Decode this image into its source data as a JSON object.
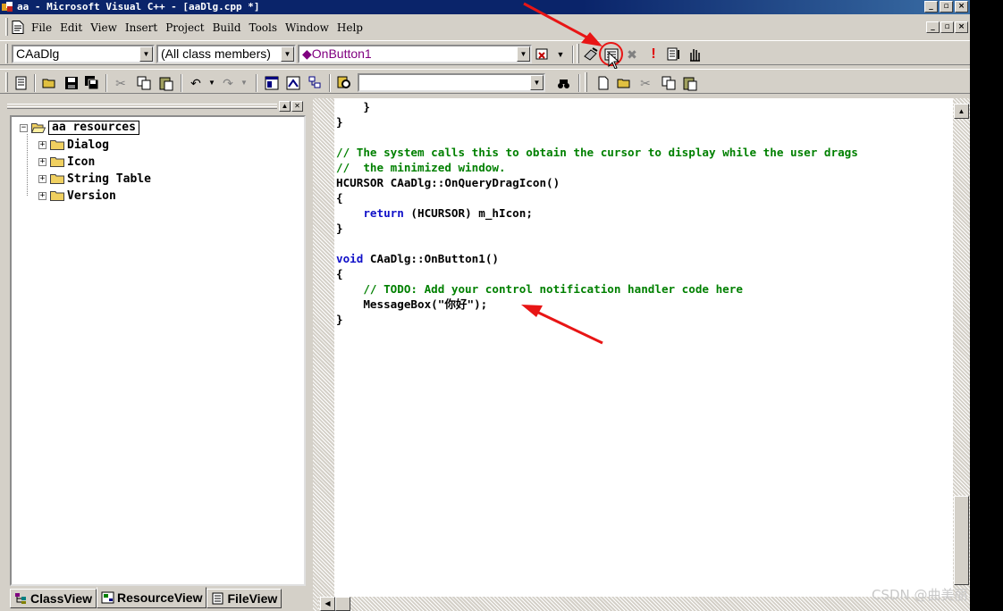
{
  "window": {
    "title": "aa - Microsoft Visual C++ - [aaDlg.cpp *]",
    "controls": [
      "_",
      "▫",
      "×"
    ]
  },
  "menu": {
    "items": [
      "File",
      "Edit",
      "View",
      "Insert",
      "Project",
      "Build",
      "Tools",
      "Window",
      "Help"
    ]
  },
  "toolbar1": {
    "class_combo": "CAaDlg",
    "filter_combo": "(All class members)",
    "member_combo": "◆OnButton1"
  },
  "toolbar2": {
    "find_combo": ""
  },
  "workspace": {
    "root": "aa resources",
    "items": [
      "Dialog",
      "Icon",
      "String Table",
      "Version"
    ],
    "tabs": [
      "ClassView",
      "ResourceView",
      "FileView"
    ]
  },
  "editor": {
    "lines": [
      [
        {
          "t": "    }",
          "c": "pl"
        }
      ],
      [
        {
          "t": "}",
          "c": "pl"
        }
      ],
      [],
      [
        {
          "t": "// The system calls this to obtain the cursor to display while the user drags",
          "c": "cm"
        }
      ],
      [
        {
          "t": "//  the minimized window.",
          "c": "cm"
        }
      ],
      [
        {
          "t": "HCURSOR CAaDlg::OnQueryDragIcon()",
          "c": "pl"
        }
      ],
      [
        {
          "t": "{",
          "c": "pl"
        }
      ],
      [
        {
          "t": "    ",
          "c": "pl"
        },
        {
          "t": "return",
          "c": "kw"
        },
        {
          "t": " (HCURSOR) m_hIcon;",
          "c": "pl"
        }
      ],
      [
        {
          "t": "}",
          "c": "pl"
        }
      ],
      [],
      [
        {
          "t": "void",
          "c": "kw"
        },
        {
          "t": " CAaDlg::OnButton1()",
          "c": "pl"
        }
      ],
      [
        {
          "t": "{",
          "c": "pl"
        }
      ],
      [
        {
          "t": "    // TODO: Add your control notification handler code here",
          "c": "cm"
        }
      ],
      [
        {
          "t": "    MessageBox(\"你好\");",
          "c": "pl"
        }
      ],
      [
        {
          "t": "}",
          "c": "pl"
        }
      ]
    ]
  },
  "watermark": "CSDN @曲美丽",
  "colors": {
    "titlebar": "#0a246a",
    "face": "#d4d0c8",
    "keyword": "#1010c8",
    "comment": "#008000",
    "annotation": "#e81515"
  }
}
